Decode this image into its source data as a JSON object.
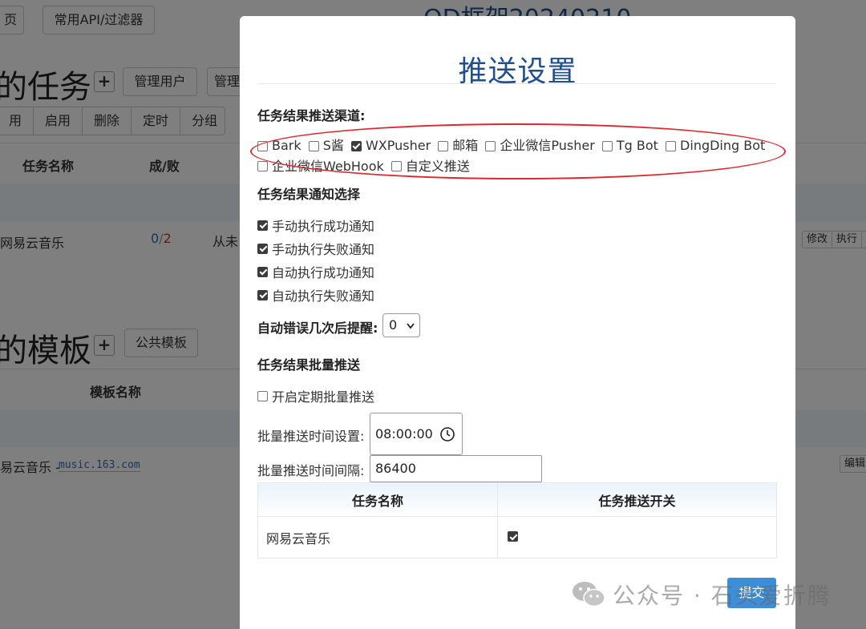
{
  "background": {
    "nav_buttons": [
      "页",
      "常用API/过滤器"
    ],
    "site_title": "QD框架20240210",
    "tasks_title": "的任务",
    "manage_users": "管理用户",
    "manage_other": "管理",
    "task_actions": [
      "用",
      "启用",
      "删除",
      "定时",
      "分组"
    ],
    "task_headers": {
      "name": "任务名称",
      "success_fail": "成/败"
    },
    "task_row": {
      "name": "网易云音乐",
      "success": "0",
      "sep": "/",
      "fail": "2",
      "last": "从未"
    },
    "row_buttons": [
      "修改",
      "执行"
    ],
    "templates_title": "的模板",
    "public_templates": "公共模板",
    "template_header": "模板名称",
    "template_row": {
      "name": "易云音乐 -",
      "domain": "music.163.com"
    },
    "edit_button": "编辑"
  },
  "modal": {
    "title": "推送设置",
    "channels_label": "任务结果推送渠道:",
    "channels": [
      {
        "label": "Bark",
        "checked": false
      },
      {
        "label": "S酱",
        "checked": false
      },
      {
        "label": "WXPusher",
        "checked": true
      },
      {
        "label": "邮箱",
        "checked": false
      },
      {
        "label": "企业微信Pusher",
        "checked": false
      },
      {
        "label": "Tg Bot",
        "checked": false
      },
      {
        "label": "DingDing Bot",
        "checked": false
      },
      {
        "label": "企业微信WebHook",
        "checked": false
      },
      {
        "label": "自定义推送",
        "checked": false
      }
    ],
    "notify_label": "任务结果通知选择",
    "notify_options": [
      {
        "label": "手动执行成功通知",
        "checked": true
      },
      {
        "label": "手动执行失败通知",
        "checked": true
      },
      {
        "label": "自动执行成功通知",
        "checked": true
      },
      {
        "label": "自动执行失败通知",
        "checked": true
      }
    ],
    "error_label": "自动错误几次后提醒:",
    "error_value": "0",
    "batch_label": "任务结果批量推送",
    "batch_enable": {
      "label": "开启定期批量推送",
      "checked": false
    },
    "batch_time_label": "批量推送时间设置:",
    "batch_time_value": "08:00:00",
    "batch_interval_label": "批量推送时间间隔:",
    "batch_interval_value": "86400",
    "table": {
      "headers": [
        "任务名称",
        "任务推送开关"
      ],
      "rows": [
        {
          "name": "网易云音乐",
          "checked": true
        }
      ]
    },
    "submit": "提交"
  },
  "watermark": {
    "text": "公众号 · 石头爱折腾"
  },
  "colors": {
    "accent": "#3d8ed6",
    "title": "#1f4f8f",
    "annotation": "#e0262e"
  }
}
